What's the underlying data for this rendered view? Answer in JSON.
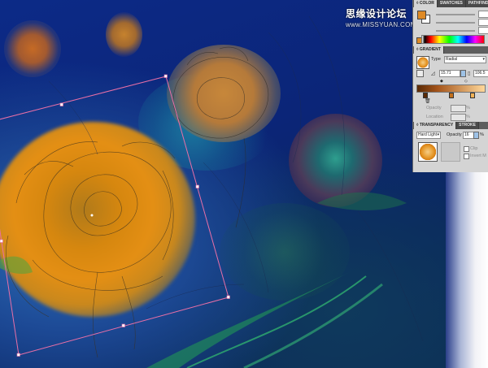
{
  "watermark": {
    "line1": "思缘设计论坛",
    "line2": "www.MISSYUAN.COM"
  },
  "color_panel": {
    "tabs": [
      "◊ COLOR",
      "SWATCHES",
      "PATHFINDER"
    ],
    "active_tab": 0,
    "fill_color": "#de8a26",
    "stroke_color": "#ffffff"
  },
  "gradient_panel": {
    "tab": "◊ GRADIENT",
    "type_label": "Type",
    "type_value": "Radial",
    "angle_value": "15.71",
    "aspect_value": "106.5",
    "opacity_label": "Opacity",
    "opacity_unit": "%",
    "location_label": "Location",
    "location_unit": "%",
    "stops": [
      {
        "color": "#5a2a06",
        "position": 0
      },
      {
        "color": "#c2701d",
        "position": 0.35
      },
      {
        "color": "#f1b155",
        "position": 0.72
      }
    ]
  },
  "transparency_panel": {
    "tabs": [
      "◊ TRANSPARENCY",
      "STROKE"
    ],
    "blend_mode": "Hard Light",
    "opacity_label": "Opacity",
    "opacity_value": "16",
    "opacity_unit": "%",
    "clip_label": "Clip",
    "invert_mask_label": "Invert M"
  },
  "colors": {
    "panel_bg": "#d4d4d4",
    "tabbar_bg": "#5e5e5e",
    "selection_box": "#e96fa6",
    "selection_handle": "#ffffff"
  },
  "icons": {
    "fill-swatch": "square",
    "stroke-swatch": "square",
    "gradient-thumbnail": "radial-square",
    "reverse-gradient": "swap",
    "angle": "triangle",
    "aspect-ratio": "ruler"
  }
}
